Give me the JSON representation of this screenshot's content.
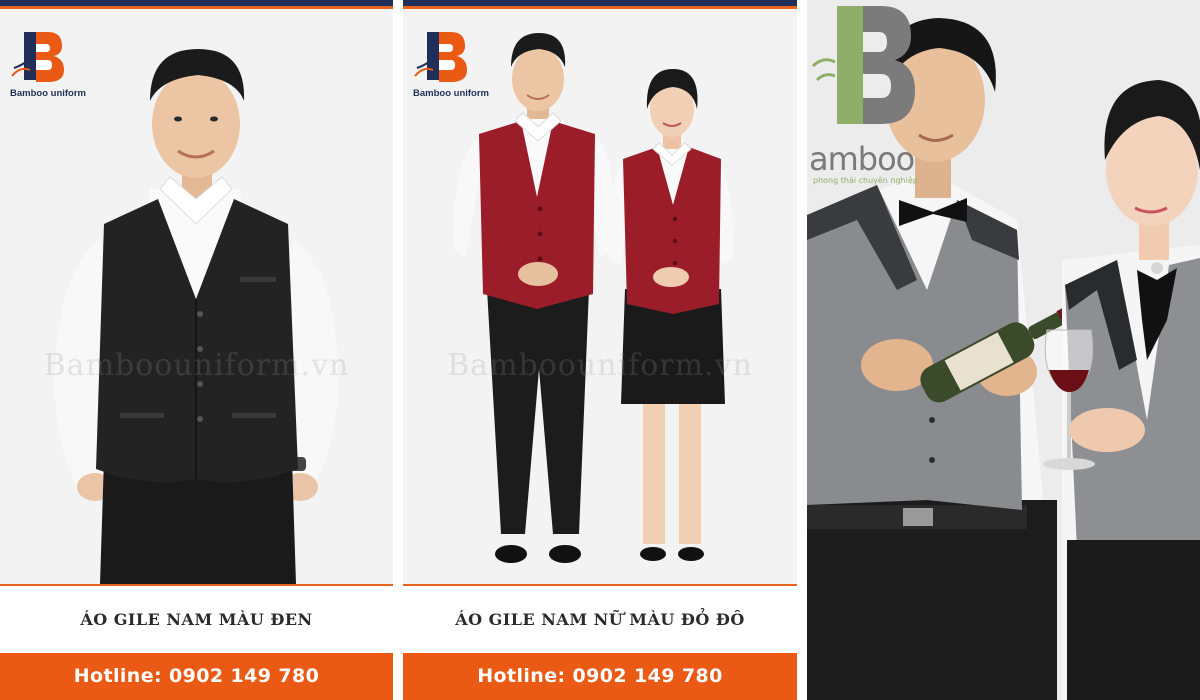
{
  "brand": {
    "name": "Bamboo uniform",
    "letter": "B"
  },
  "watermark": "Bamboouniform.vn",
  "panels": [
    {
      "caption": "ÁO GILE NAM MÀU ĐEN",
      "hotline": "Hotline: 0902 149 780",
      "subject": "man-black-vest"
    },
    {
      "caption": "ÁO GILE NAM NỮ MÀU ĐỎ ĐÔ",
      "hotline": "Hotline: 0902 149 780",
      "subject": "couple-burgundy-vests"
    },
    {
      "subject": "waiters-grey-vests-wine",
      "logo_word": "amboo",
      "logo_tagline": "phong thái chuyên nghiệp"
    }
  ],
  "colors": {
    "navy": "#1f2f57",
    "orange": "#ea5a14",
    "burgundy": "#9b1d2a",
    "green": "#8fae6a"
  }
}
